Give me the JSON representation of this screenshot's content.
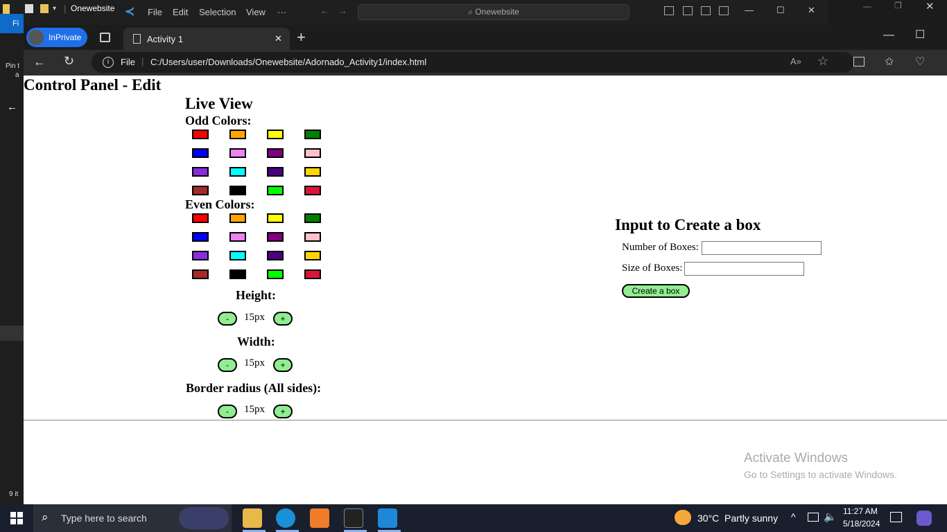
{
  "explorer": {
    "folder_title": "Onewebsite",
    "tab_label": "Fi",
    "pin_text": "Pin t",
    "pin_text2": "a",
    "item_count": "9 it"
  },
  "vscode": {
    "menu": [
      "File",
      "Edit",
      "Selection",
      "View",
      "···"
    ],
    "search_text": "Onewebsite"
  },
  "browser": {
    "inprivate_label": "InPrivate",
    "tab_title": "Activity 1",
    "file_label": "File",
    "url": "C:/Users/user/Downloads/Onewebsite/Adornado_Activity1/index.html"
  },
  "page": {
    "title": "Control Panel - Edit",
    "live_view": "Live View",
    "odd_label": "Odd Colors:",
    "even_label": "Even Colors:",
    "colors": [
      "#ff0000",
      "#ffa500",
      "#ffff00",
      "#008000",
      "#0000ff",
      "#ee82ee",
      "#800080",
      "#ffc0cb",
      "#8a2be2",
      "#00ffff",
      "#4b0082",
      "#ffd700",
      "#a52a2a",
      "#000000",
      "#00ff00",
      "#dc143c"
    ],
    "height_label": "Height:",
    "height_value": "15px",
    "width_label": "Width:",
    "width_value": "15px",
    "radius_label": "Border radius (All sides):",
    "radius_value": "15px",
    "minus": "-",
    "plus": "+",
    "create_heading": "Input to Create a box",
    "number_label": "Number of Boxes:",
    "size_label": "Size of Boxes:",
    "create_button": "Create a box",
    "activate_title": "Activate Windows",
    "activate_sub": "Go to Settings to activate Windows."
  },
  "taskbar": {
    "search_placeholder": "Type here to search",
    "weather": "30°C  Partly sunny",
    "time": "11:27 AM",
    "date": "5/18/2024"
  },
  "accent_colors": {
    "button_green": "#90ee90",
    "inprivate_blue": "#1f6feb"
  }
}
